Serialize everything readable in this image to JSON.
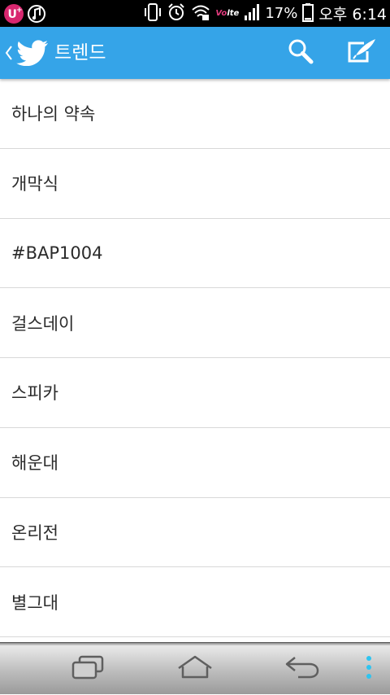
{
  "status_bar": {
    "battery_text": "17%",
    "time_text": "오후 6:14",
    "network_label_prefix": "Vo",
    "network_label": "lte",
    "icons": [
      "u-plus-icon",
      "music-icon",
      "phone-vibrate-icon",
      "alarm-icon",
      "wifi-icon",
      "signal-icon",
      "battery-icon"
    ]
  },
  "action_bar": {
    "title": "트렌드",
    "background_color": "#35a4e8",
    "icons": [
      "up-caret-icon",
      "twitter-bird-icon",
      "search-icon",
      "compose-icon"
    ]
  },
  "trends": [
    {
      "label": "하나의 약속"
    },
    {
      "label": "개막식"
    },
    {
      "label": "#BAP1004"
    },
    {
      "label": "걸스데이"
    },
    {
      "label": "스피카"
    },
    {
      "label": "해운대"
    },
    {
      "label": "온리전"
    },
    {
      "label": "별그대"
    }
  ],
  "nav_bar": {
    "icons": [
      "recent-apps-icon",
      "home-icon",
      "back-icon",
      "menu-dots-icon"
    ],
    "menu_dots_color": "#2ec4f0"
  }
}
